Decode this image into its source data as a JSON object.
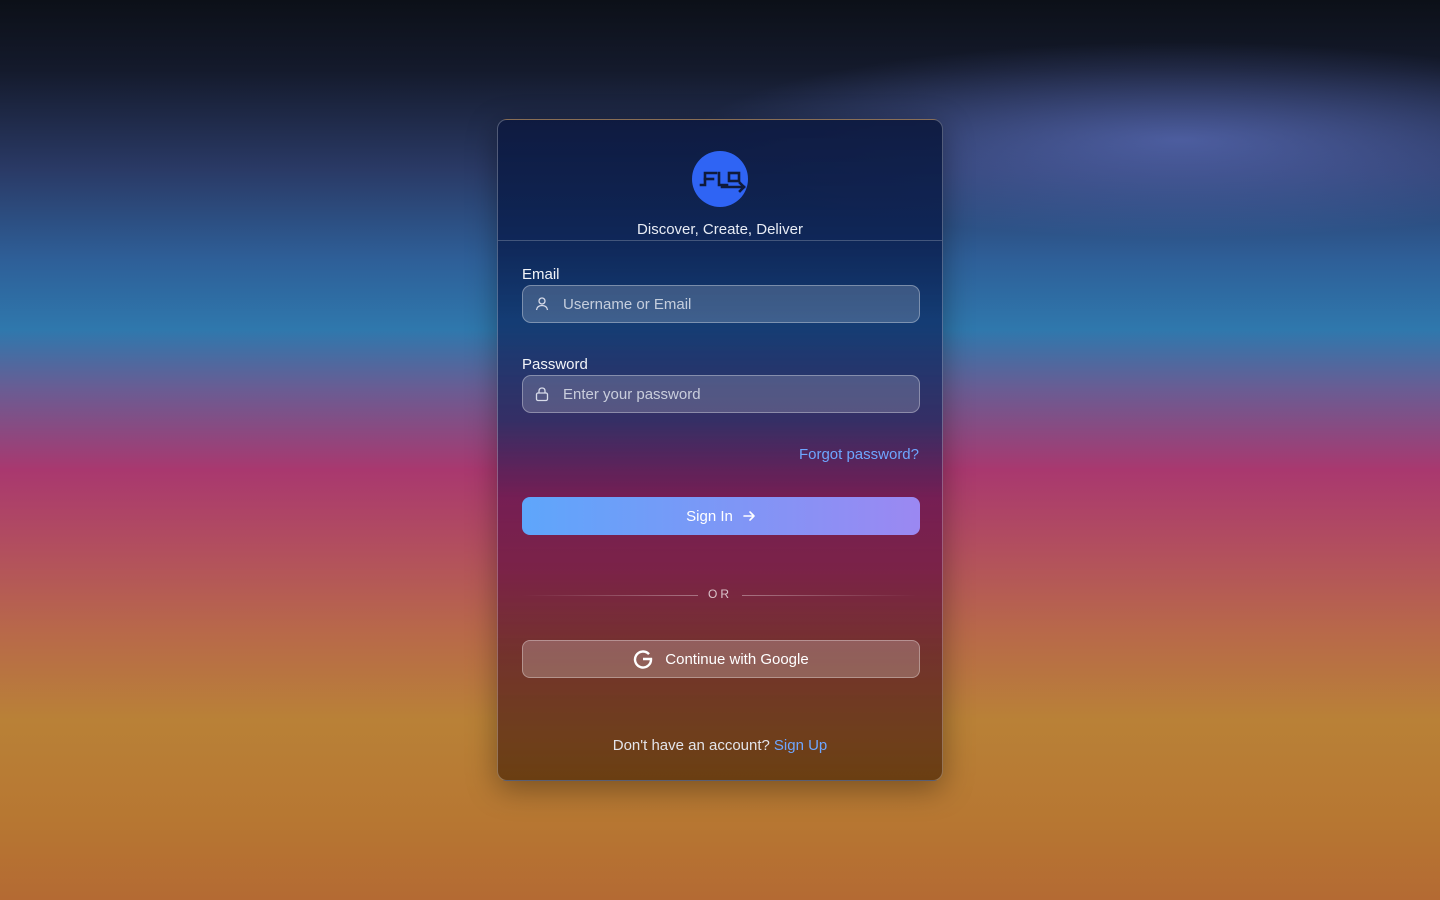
{
  "brand": {
    "logo_icon": "flo-logo-icon",
    "tagline": "Discover, Create, Deliver",
    "logo_color": "#2f64f4"
  },
  "form": {
    "email": {
      "label": "Email",
      "placeholder": "Username or Email",
      "value": "",
      "icon": "user-icon"
    },
    "password": {
      "label": "Password",
      "placeholder": "Enter your password",
      "value": "",
      "icon": "lock-icon"
    },
    "forgot_password": "Forgot password?",
    "sign_in_label": "Sign In",
    "sign_in_icon": "arrow-right-icon",
    "divider_text": "OR",
    "google_label": "Continue with Google",
    "google_icon": "google-icon"
  },
  "footer": {
    "prompt": "Don't have an account?",
    "sign_up": "Sign Up"
  },
  "colors": {
    "link": "#6ea6ff",
    "button_gradient_start": "#5ea6fb",
    "button_gradient_end": "#9b88f2"
  }
}
